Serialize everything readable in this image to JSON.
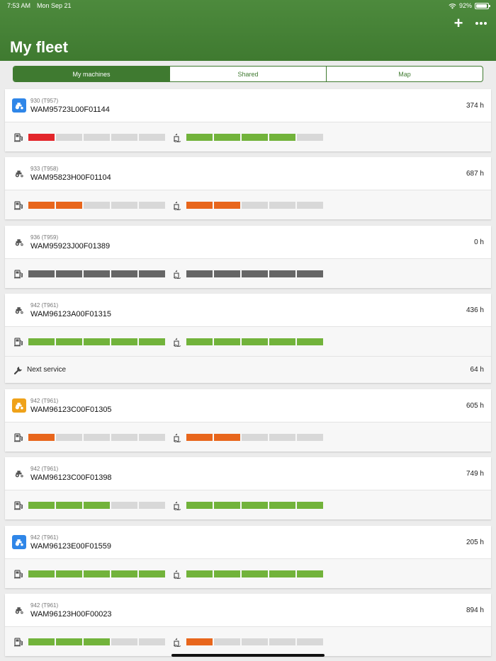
{
  "status_bar": {
    "time": "7:53 AM",
    "date": "Mon Sep 21",
    "battery": "92%",
    "battery_level": 0.92
  },
  "header": {
    "title": "My fleet",
    "add_label": "+",
    "more_icon": "ellipsis-icon"
  },
  "tabs": [
    {
      "label": "My machines",
      "active": true
    },
    {
      "label": "Shared",
      "active": false
    },
    {
      "label": "Map",
      "active": false
    }
  ],
  "colors": {
    "header": "#3f7a30",
    "green": "#72b33b",
    "orange": "#e8661c",
    "red": "#e3262b",
    "dark": "#666666",
    "empty": "#d8d8d8",
    "icon_blue": "#2f86e8",
    "icon_orange": "#efa21a"
  },
  "machines": [
    {
      "model": "930 (T957)",
      "serial": "WAM95723L00F01144",
      "hours": "374 h",
      "icon_style": "blue",
      "fuel_level": 1,
      "fuel_color": "red",
      "def_level": 4,
      "def_color": "green"
    },
    {
      "model": "933 (T958)",
      "serial": "WAM95823H00F01104",
      "hours": "687 h",
      "icon_style": "plain",
      "fuel_level": 2,
      "fuel_color": "orange",
      "def_level": 2,
      "def_color": "orange"
    },
    {
      "model": "936 (T959)",
      "serial": "WAM95923J00F01389",
      "hours": "0 h",
      "icon_style": "plain",
      "fuel_level": 5,
      "fuel_color": "dark",
      "def_level": 5,
      "def_color": "dark"
    },
    {
      "model": "942 (T961)",
      "serial": "WAM96123A00F01315",
      "hours": "436 h",
      "icon_style": "plain",
      "fuel_level": 5,
      "fuel_color": "green",
      "def_level": 5,
      "def_color": "green",
      "service": {
        "label": "Next service",
        "hours": "64 h"
      }
    },
    {
      "model": "942 (T961)",
      "serial": "WAM96123C00F01305",
      "hours": "605 h",
      "icon_style": "orange",
      "fuel_level": 1,
      "fuel_color": "orange",
      "def_level": 2,
      "def_color": "orange"
    },
    {
      "model": "942 (T961)",
      "serial": "WAM96123C00F01398",
      "hours": "749 h",
      "icon_style": "plain",
      "fuel_level": 3,
      "fuel_color": "green",
      "def_level": 5,
      "def_color": "green"
    },
    {
      "model": "942 (T961)",
      "serial": "WAM96123E00F01559",
      "hours": "205 h",
      "icon_style": "blue",
      "fuel_level": 5,
      "fuel_color": "green",
      "def_level": 5,
      "def_color": "green"
    },
    {
      "model": "942 (T961)",
      "serial": "WAM96123H00F00023",
      "hours": "894 h",
      "icon_style": "plain",
      "fuel_level": 3,
      "fuel_color": "green",
      "def_level": 1,
      "def_color": "orange"
    }
  ]
}
